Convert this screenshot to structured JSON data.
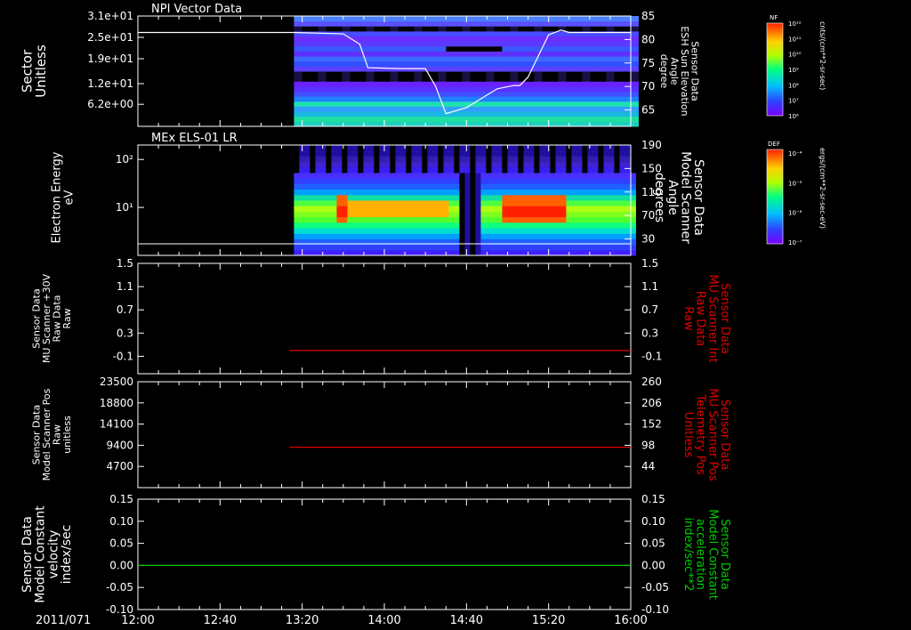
{
  "time_axis": {
    "start_label": "2011/071",
    "ticks": [
      "12:00",
      "12:40",
      "13:20",
      "14:00",
      "14:40",
      "15:20",
      "16:00"
    ],
    "tick_minutes": [
      0,
      40,
      80,
      120,
      160,
      200,
      240
    ],
    "range_minutes": [
      0,
      240
    ]
  },
  "colors": {
    "background": "#000000",
    "axes": "#ffffff",
    "trace_red": "#e00000",
    "trace_green": "#00cc00",
    "trace_white": "#ffffff"
  },
  "chart_data": [
    {
      "type": "heatmap",
      "title": "NPI Vector Data",
      "ylabel": [
        "Sector",
        "Unitless"
      ],
      "y_ticks": [
        "3.1e+01",
        "2.5e+01",
        "1.9e+01",
        "1.2e+01",
        "6.2e+00"
      ],
      "y_tick_values": [
        31,
        25,
        19,
        12,
        6.2
      ],
      "ylim": [
        0,
        31
      ],
      "data_start_minutes": 76,
      "y2label": [
        "Sensor Data",
        "ESH Sun Elevation",
        "Angle",
        "degree"
      ],
      "y2_ticks": [
        "85",
        "80",
        "75",
        "70",
        "65"
      ],
      "y2_tick_values": [
        85,
        80,
        75,
        70,
        65
      ],
      "y2lim": [
        61.5,
        85
      ],
      "overlay_series": {
        "name": "ESH Sun Elevation Angle",
        "x": [
          0,
          76,
          100,
          108,
          112,
          128,
          140,
          145,
          150,
          160,
          175,
          183,
          186,
          190,
          200,
          206,
          210,
          240
        ],
        "y": [
          81.5,
          81.5,
          81.2,
          79,
          74,
          73.8,
          73.8,
          70,
          64.2,
          65.5,
          69.5,
          70.2,
          70.2,
          72,
          81,
          82,
          81.5,
          81.5
        ]
      },
      "colorbar": {
        "label": "NF",
        "units": "cnts/(cm**2-sr-sec)",
        "ticks": [
          "10¹²",
          "10¹¹",
          "10¹⁰",
          "10⁹",
          "10⁸",
          "10⁷",
          "10⁶"
        ]
      }
    },
    {
      "type": "heatmap",
      "title": "MEx ELS-01 LR",
      "ylabel": [
        "Electron Energy",
        "eV"
      ],
      "y_ticks": [
        "10²",
        "10¹"
      ],
      "y_tick_values": [
        100,
        10
      ],
      "ylim_log": [
        1,
        200
      ],
      "data_start_minutes": 76,
      "y2label": [
        "Sensor Data",
        "Model Scanner",
        "Angle",
        "degrees"
      ],
      "y2_ticks": [
        "190",
        "150",
        "110",
        "70",
        "30"
      ],
      "y2_tick_values": [
        190,
        150,
        110,
        70,
        30
      ],
      "y2lim": [
        2,
        190
      ],
      "overlay_series": {
        "name": "Model Scanner Angle",
        "x": [
          0,
          240
        ],
        "y": [
          10,
          10
        ]
      },
      "colorbar": {
        "label": "DEF",
        "units": "ergs/(cm**2-sr-sec-eV)",
        "ticks": [
          "10⁻⁴",
          "10⁻⁵",
          "10⁻⁶",
          "10⁻⁷"
        ]
      }
    },
    {
      "type": "line",
      "ylabel": [
        "Sensor Data",
        "MU Scanner +30V",
        "Raw Data",
        "Raw"
      ],
      "y_ticks": [
        "1.5",
        "1.1",
        "0.7",
        "0.3",
        "-0.1"
      ],
      "y_tick_values": [
        1.5,
        1.1,
        0.7,
        0.3,
        -0.1
      ],
      "ylim": [
        -0.4,
        1.5
      ],
      "y2label": [
        "Sensor Data",
        "MU Scanner Int",
        "Raw Data",
        "Raw"
      ],
      "y2_ticks": [
        "1.5",
        "1.1",
        "0.7",
        "0.3",
        "-0.1"
      ],
      "y2_tick_values": [
        1.5,
        1.1,
        0.7,
        0.3,
        -0.1
      ],
      "y2lim": [
        -0.4,
        1.5
      ],
      "series": [
        {
          "x": [
            74,
            240
          ],
          "y": [
            0.0,
            0.0
          ],
          "color": "#e00000",
          "axis": "y2"
        }
      ]
    },
    {
      "type": "line",
      "ylabel": [
        "Sensor Data",
        "Model Scanner Pos",
        "Raw",
        "unitless"
      ],
      "y_ticks": [
        "23500",
        "18800",
        "14100",
        "9400",
        "4700"
      ],
      "y_tick_values": [
        23500,
        18800,
        14100,
        9400,
        4700
      ],
      "ylim": [
        0,
        23500
      ],
      "y2label": [
        "Sensor Data",
        "MU Scanner Pos",
        "Telemetry Pos",
        "Unitless"
      ],
      "y2_ticks": [
        "260",
        "206",
        "152",
        "98",
        "44"
      ],
      "y2_tick_values": [
        260,
        206,
        152,
        98,
        44
      ],
      "y2lim": [
        -10,
        260
      ],
      "series": [
        {
          "x": [
            74,
            240
          ],
          "y": [
            93,
            93
          ],
          "color": "#e00000",
          "axis": "y2"
        }
      ]
    },
    {
      "type": "line",
      "ylabel": [
        "Sensor Data",
        "Model Constant",
        "velocity",
        "index/sec"
      ],
      "y_ticks": [
        "0.15",
        "0.10",
        "0.05",
        "0.00",
        "-0.05",
        "-0.10"
      ],
      "y_tick_values": [
        0.15,
        0.1,
        0.05,
        0.0,
        -0.05,
        -0.1
      ],
      "ylim": [
        -0.1,
        0.15
      ],
      "y2label": [
        "Sensor Data",
        "Model Constant",
        "acceleration",
        "index/sec**2"
      ],
      "y2_ticks": [
        "0.15",
        "0.10",
        "0.05",
        "0.00",
        "-0.05",
        "-0.10"
      ],
      "y2_tick_values": [
        0.15,
        0.1,
        0.05,
        0.0,
        -0.05,
        -0.1
      ],
      "y2lim": [
        -0.1,
        0.15
      ],
      "series": [
        {
          "x": [
            0,
            240
          ],
          "y": [
            0.0,
            0.0
          ],
          "color": "#00cc00",
          "axis": "y"
        }
      ]
    }
  ]
}
